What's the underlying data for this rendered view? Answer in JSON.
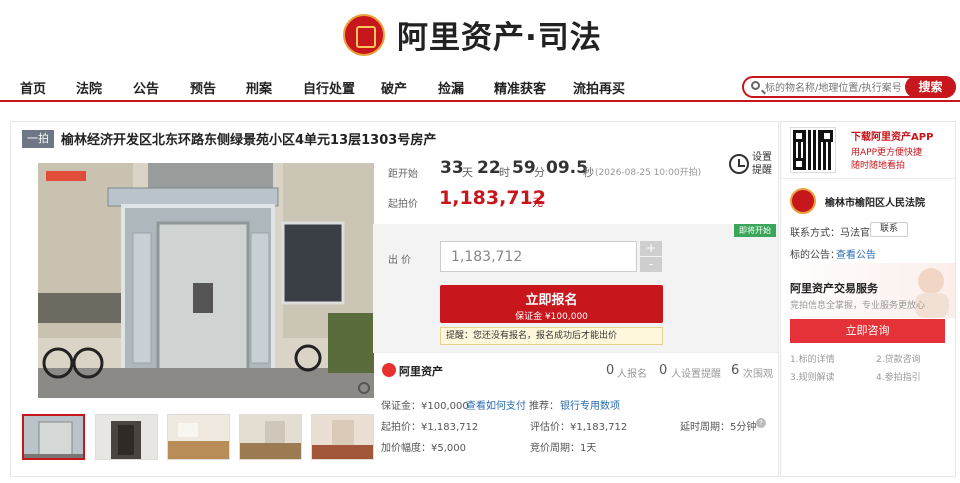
{
  "header": {
    "logo_text": "阿里资产·司法"
  },
  "nav": {
    "items": [
      "首页",
      "法院",
      "公告",
      "预告",
      "刑案",
      "自行处置",
      "破产",
      "捡漏",
      "精准获客",
      "流拍再买"
    ]
  },
  "search": {
    "placeholder": "标的物名称/地理位置/执行案号",
    "button": "搜索"
  },
  "item": {
    "stage": "一拍",
    "title": "榆林经济开发区北东环路东侧绿景苑小区4单元13层1303号房产"
  },
  "countdown": {
    "label": "距开始",
    "days": "33",
    "day_unit": "天",
    "hours": "22",
    "hour_unit": "时",
    "minutes": "59",
    "minute_unit": "分",
    "seconds": "09.5",
    "second_unit": "秒",
    "start_time": "(2026-08-25 10:00开拍)"
  },
  "reminder": {
    "label": "设置提醒"
  },
  "start_price": {
    "label": "起拍价",
    "value": "1,183,712",
    "unit": "元"
  },
  "bid": {
    "soon_badge": "即将开始",
    "label": "出 价",
    "value": "1,183,712",
    "plus": "+",
    "minus": "-",
    "apply_label": "立即报名",
    "deposit_label": "保证金 ¥100,000",
    "tip": "提醒：您还没有报名，报名成功后才能出价"
  },
  "brand": {
    "name": "阿里资产"
  },
  "stats": [
    {
      "value": "0",
      "label": "人报名"
    },
    {
      "value": "0",
      "label": "人设置提醒"
    },
    {
      "value": "6",
      "label": "次围观"
    }
  ],
  "details": {
    "deposit": "保证金：¥100,000",
    "how_to_pay": "查看如何支付",
    "recommend_label": "推荐：",
    "bank_loan": "银行专用数项",
    "start_price": "起拍价：¥1,183,712",
    "assessed": "评估价：¥1,183,712",
    "delay": "延时周期：5分钟",
    "increment": "加价幅度：¥5,000",
    "auction_period": "竞价周期：1天"
  },
  "sidebar": {
    "app_title": "下载阿里资产APP",
    "app_sub1": "用APP更方便快捷",
    "app_sub2": "随时随地看拍",
    "court": "榆林市榆阳区人民法院",
    "contact_label": "联系方式：马法官",
    "contact_button": "联系",
    "notice_label": "标的公告：",
    "notice_link": "查看公告",
    "promo_title": "阿里资产交易服务",
    "promo_sub": "竞拍信息全掌握，专业服务更放心",
    "consult_button": "立即咨询",
    "faq": [
      "1.标的详情",
      "2.贷款咨询",
      "3.规则解读",
      "4.参拍指引"
    ]
  },
  "colors": {
    "brand_red": "#c8161d",
    "badge_green": "#3aa55b"
  }
}
